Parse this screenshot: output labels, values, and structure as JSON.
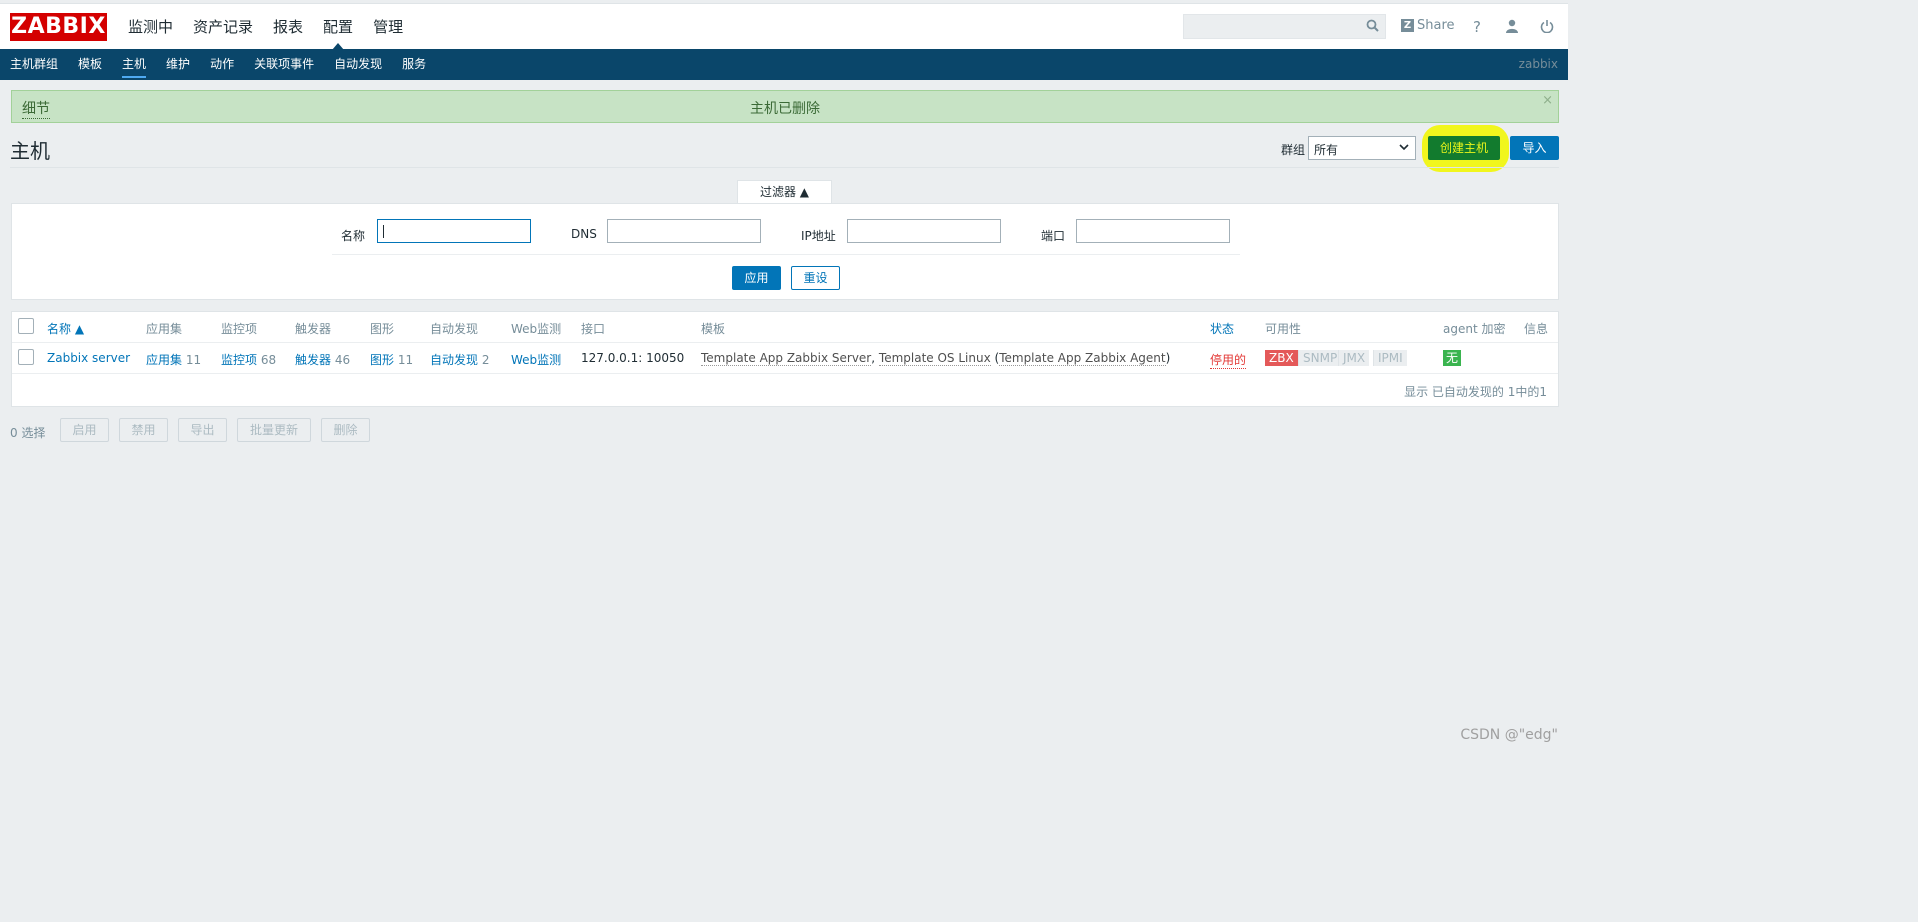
{
  "logo": "ZABBIX",
  "main_menu": [
    "监测中",
    "资产记录",
    "报表",
    "配置",
    "管理"
  ],
  "share": {
    "icon": "z-icon",
    "label": "Share"
  },
  "sub_menu": [
    "主机群组",
    "模板",
    "主机",
    "维护",
    "动作",
    "关联项事件",
    "自动发现",
    "服务"
  ],
  "sub_user": "zabbix",
  "message": {
    "details": "细节",
    "text": "主机已删除",
    "close": "×"
  },
  "page_title": "主机",
  "group": {
    "label": "群组",
    "value": "所有"
  },
  "buttons": {
    "create": "创建主机",
    "import": "导入"
  },
  "filter": {
    "tab": "过滤器 ▲",
    "name_label": "名称",
    "dns_label": "DNS",
    "ip_label": "IP地址",
    "port_label": "端口",
    "apply": "应用",
    "reset": "重设"
  },
  "table": {
    "headers": [
      "名称 ▲",
      "应用集",
      "监控项",
      "触发器",
      "图形",
      "自动发现",
      "Web监测",
      "接口",
      "模板",
      "状态",
      "可用性",
      "agent 加密",
      "信息"
    ],
    "row": {
      "name": "Zabbix server",
      "apps_label": "应用集",
      "apps_count": "11",
      "items_label": "监控项",
      "items_count": "68",
      "triggers_label": "触发器",
      "triggers_count": "46",
      "graphs_label": "图形",
      "graphs_count": "11",
      "discovery_label": "自动发现",
      "discovery_count": "2",
      "web_label": "Web监测",
      "interface": "127.0.0.1: 10050",
      "template1": "Template App Zabbix Server",
      "sep1": ",",
      "template2": "Template OS Linux",
      "paren_open": "(",
      "template3": "Template App Zabbix Agent",
      "paren_close": ")",
      "status": "停用的",
      "avail": [
        "ZBX",
        "SNMP",
        "JMX",
        "IPMI"
      ],
      "encryption": "无"
    },
    "footer": "显示 已自动发现的 1中的1"
  },
  "actions": {
    "selected": "0 选择",
    "buttons": [
      "启用",
      "禁用",
      "导出",
      "批量更新",
      "删除"
    ]
  },
  "watermark": "CSDN @\"edg\""
}
